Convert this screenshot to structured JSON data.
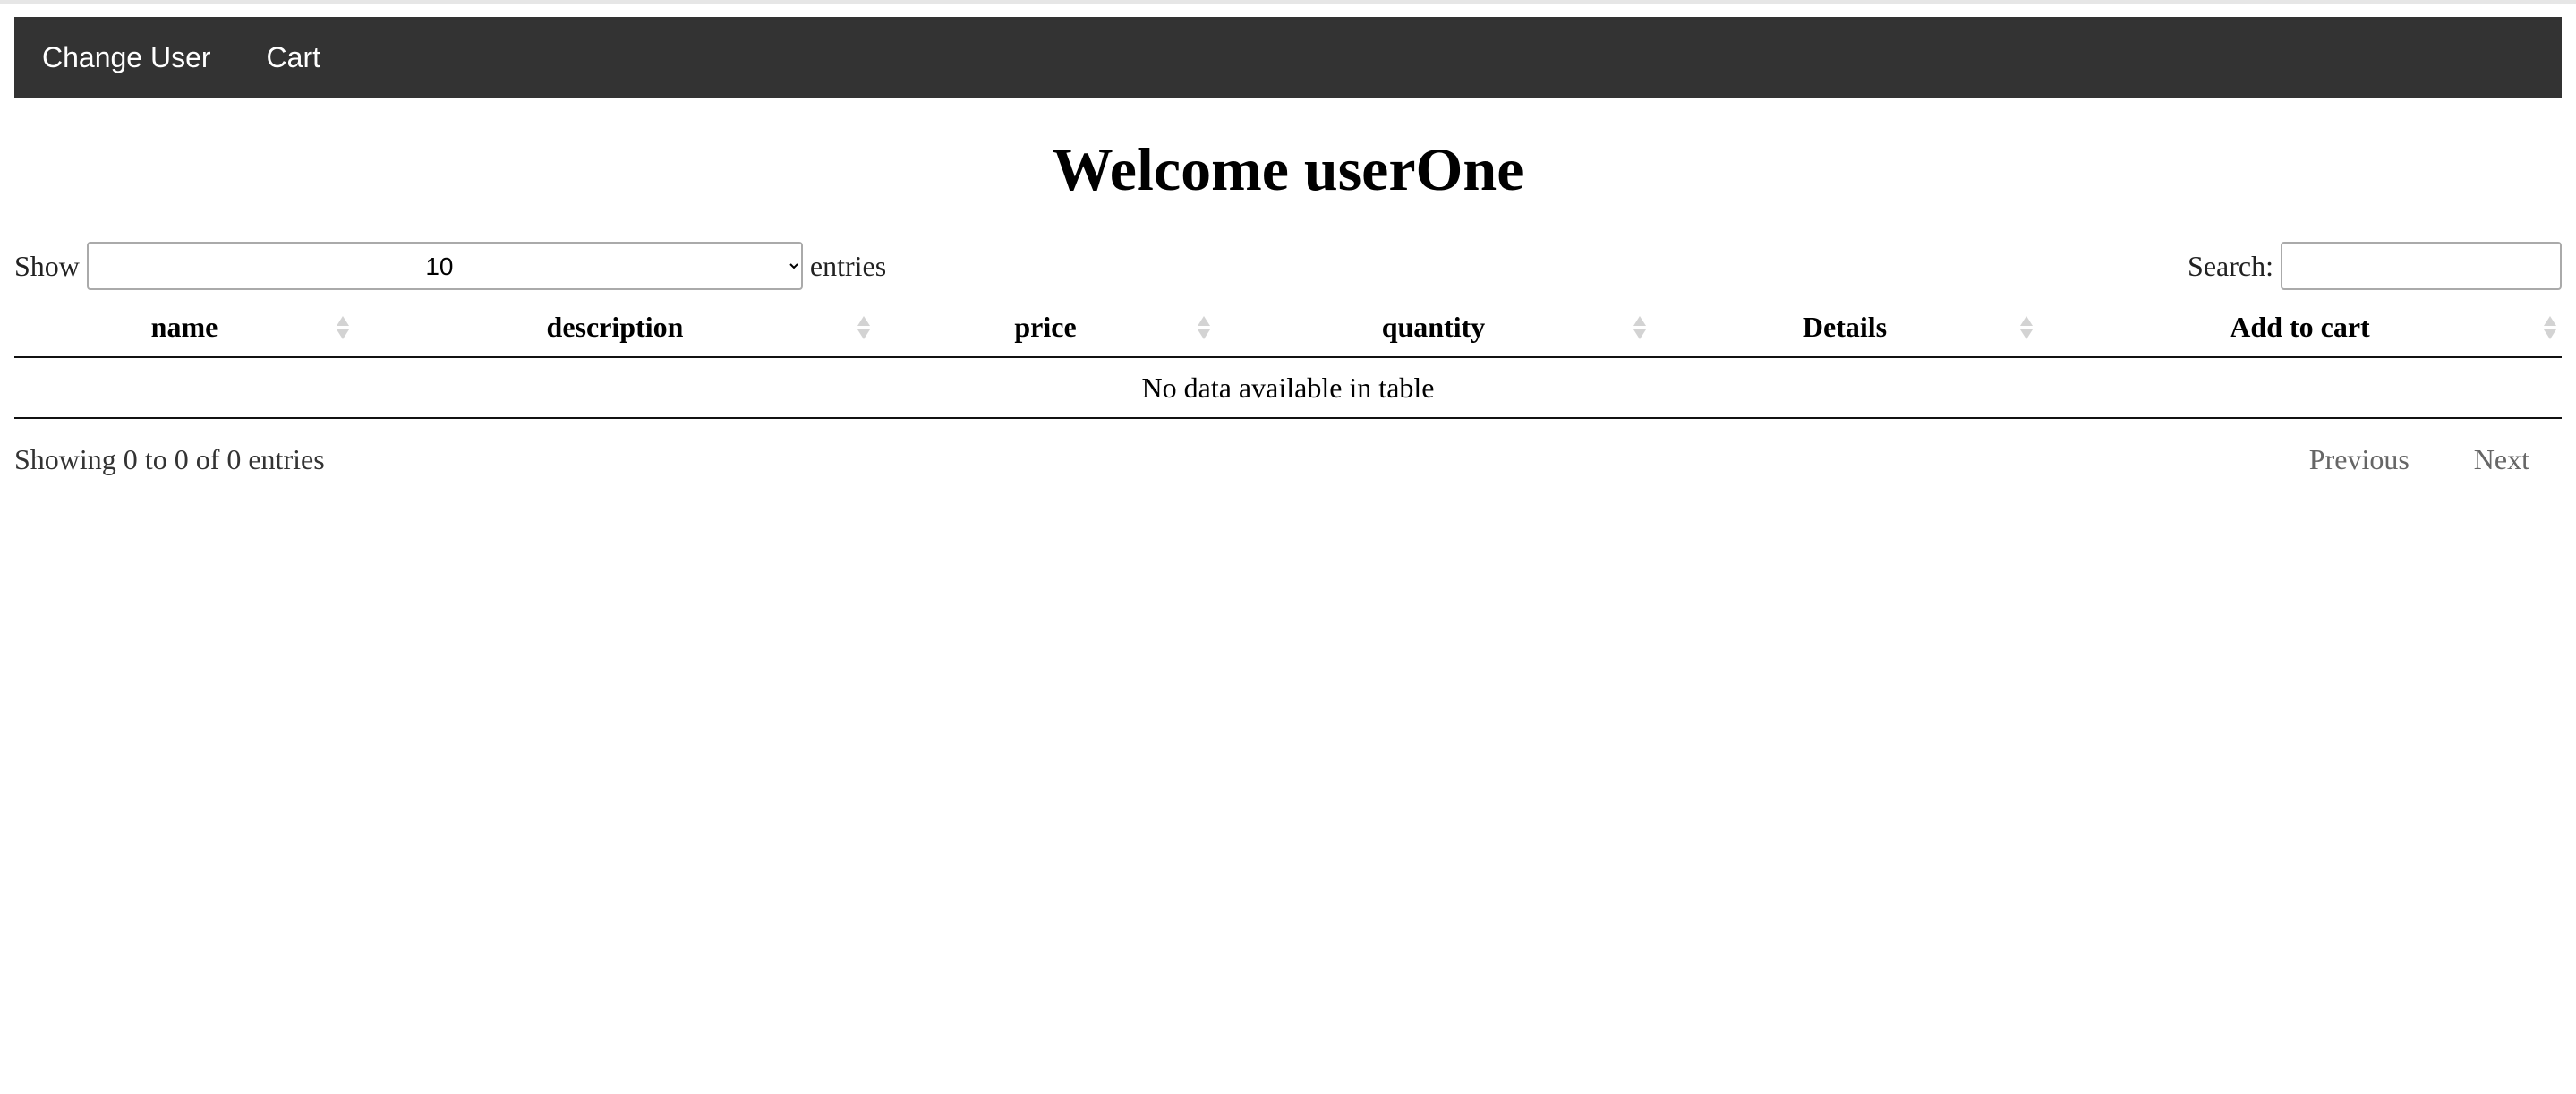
{
  "navbar": {
    "items": [
      {
        "label": "Change User"
      },
      {
        "label": "Cart"
      }
    ]
  },
  "page": {
    "title": "Welcome userOne"
  },
  "length_control": {
    "show_label": "Show",
    "selected_value": "10",
    "entries_label": "entries"
  },
  "search": {
    "label": "Search:",
    "value": "",
    "placeholder": ""
  },
  "table": {
    "columns": [
      {
        "label": "name"
      },
      {
        "label": "description"
      },
      {
        "label": "price"
      },
      {
        "label": "quantity"
      },
      {
        "label": "Details"
      },
      {
        "label": "Add to cart"
      }
    ],
    "empty_message": "No data available in table"
  },
  "footer": {
    "info": "Showing 0 to 0 of 0 entries",
    "previous_label": "Previous",
    "next_label": "Next"
  },
  "colors": {
    "navbar_bg": "#333333",
    "navbar_text": "#ffffff",
    "disabled_pagination": "#666666"
  }
}
